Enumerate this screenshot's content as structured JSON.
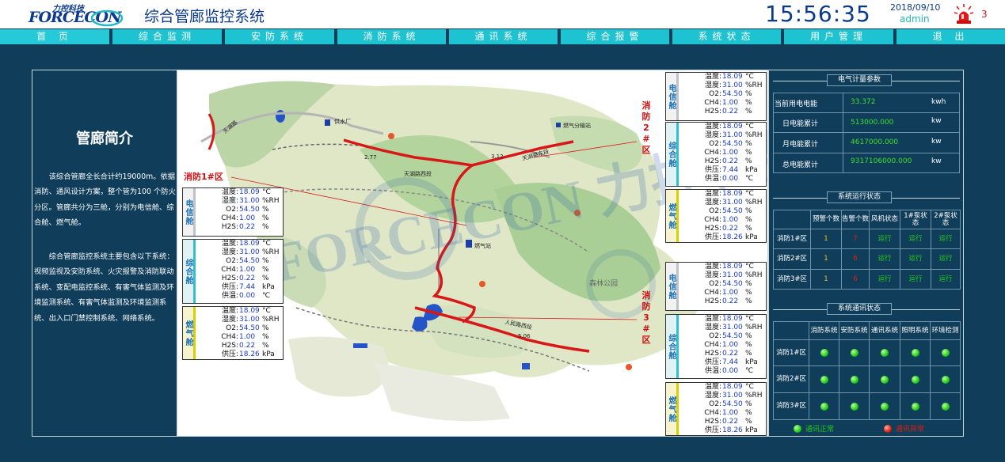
{
  "header": {
    "logo_cn": "力控科技",
    "logo_en": "FORCECON",
    "title": "综合管廊监控系统",
    "time": "15:56:35",
    "date": "2018/09/10",
    "user": "admin",
    "alarm_count": "3",
    "alarm_color": "#e01818"
  },
  "nav": [
    "首 页",
    "综合监测",
    "安防系统",
    "消防系统",
    "通讯系统",
    "综合报警",
    "系统状态",
    "用户管理",
    "退 出"
  ],
  "overview": {
    "title": "管廊简介",
    "para1": "　　该综合管廊全长合计约19000m。依据消防、通风设计方案，整个管为100 个防火分区。管廊共分为三舱，分别为电信舱、综合舱、燃气舱。",
    "para2": "　　综合管廊监控系统主要包含以下系统：视频监视及安防系统、火灾报警及消防联动系统、变配电监控系统、有害气体监测及环境监测系统、有害气体监测及环境监测系统、出入口门禁控制系统、网络系统。"
  },
  "map": {
    "zone1": "消防1#区",
    "zone2": [
      "消",
      "防",
      "2",
      "#",
      "区"
    ],
    "zone3": [
      "消",
      "防",
      "3",
      "#",
      "区"
    ],
    "roads": [
      "天湖路西段",
      "天湖路东段",
      "人民路西段",
      "天湖路"
    ],
    "places": [
      "供水厂",
      "燃气分输站",
      "燃气站",
      "森林公园"
    ],
    "distances": [
      "2.77",
      "3.12",
      "5.06"
    ],
    "watermark": "FORCECON 力控科技",
    "route_color": "#d81818"
  },
  "labels": {
    "temp": "温度:",
    "humid": "湿度:",
    "o2": "O2:",
    "ch4": "CH4:",
    "h2s": "H2S:",
    "supply_p": "供压:",
    "supply_t": "供温:",
    "u_temp": "°C",
    "u_temp2": "℃",
    "u_humid": "%RH",
    "u_pct": "%",
    "u_kpa": "kPa"
  },
  "values": {
    "temp": "18.09",
    "humid": "31.00",
    "o2": "54.50",
    "ch4": "1.00",
    "h2s": "0.22",
    "supply_p_int": "7.44",
    "supply_t": "0.00",
    "supply_p_gas": "18.26"
  },
  "cabins": {
    "tel": "电信舱",
    "int": "综合舱",
    "gas": "燃气舱"
  },
  "energy": {
    "title": "电气计量参数",
    "rows": [
      {
        "label": "当前用电电能",
        "value": "33.372",
        "unit": "kwh"
      },
      {
        "label": "日电能累计",
        "value": "513000.000",
        "unit": "kw"
      },
      {
        "label": "月电能累计",
        "value": "4617000.000",
        "unit": "kw"
      },
      {
        "label": "总电能累计",
        "value": "9317106000.000",
        "unit": "kw"
      }
    ]
  },
  "run_status": {
    "title": "系统运行状态",
    "headers": [
      "预警个数",
      "告警个数",
      "风机状态",
      "1#泵状态",
      "2#泵状态"
    ],
    "rows": [
      {
        "zone": "消防1#区",
        "warn": "1",
        "alarm": "7",
        "fan": "运行",
        "pump1": "运行",
        "pump2": "运行"
      },
      {
        "zone": "消防2#区",
        "warn": "1",
        "alarm": "6",
        "fan": "运行",
        "pump1": "运行",
        "pump2": "运行"
      },
      {
        "zone": "消防3#区",
        "warn": "1",
        "alarm": "6",
        "fan": "运行",
        "pump1": "运行",
        "pump2": "运行"
      }
    ]
  },
  "comm_status": {
    "title": "系统通讯状态",
    "headers": [
      "消防系统",
      "安防系统",
      "通讯系统",
      "照明系统",
      "环境检测"
    ],
    "rows": [
      "消防1#区",
      "消防2#区",
      "消防3#区"
    ],
    "legend_ok": "通讯正常",
    "legend_err": "通讯异常",
    "ok_color": "#22cc18",
    "err_color": "#e02010"
  }
}
